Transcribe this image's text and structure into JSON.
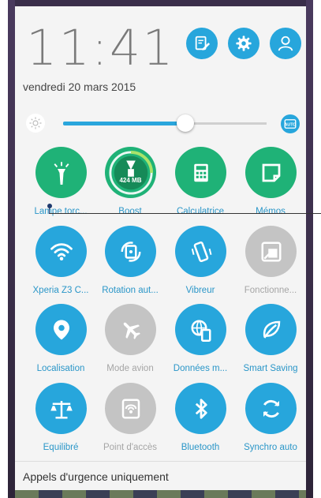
{
  "status": {
    "time": "11:41",
    "date": "vendredi 20 mars 2015"
  },
  "header": {
    "buttons": [
      {
        "icon": "edit-icon"
      },
      {
        "icon": "gear-icon"
      },
      {
        "icon": "user-icon"
      }
    ]
  },
  "brightness": {
    "level": 0.6,
    "auto_label": "AUTO"
  },
  "tiles": [
    {
      "label": "Lampe torc...",
      "icon": "flashlight-icon",
      "state": "on"
    },
    {
      "label": "Boost",
      "icon": "boost-icon",
      "state": "on",
      "badge": "424 MB"
    },
    {
      "label": "Calculatrice",
      "icon": "calculator-icon",
      "state": "on"
    },
    {
      "label": "Mémos",
      "icon": "memo-icon",
      "state": "on"
    },
    {
      "label": "Xperia Z3 C...",
      "icon": "wifi-icon",
      "state": "on"
    },
    {
      "label": "Rotation aut...",
      "icon": "rotation-icon",
      "state": "on"
    },
    {
      "label": "Vibreur",
      "icon": "vibrate-icon",
      "state": "on"
    },
    {
      "label": "Fonctionne...",
      "icon": "screen-mirror-icon",
      "state": "off"
    },
    {
      "label": "Localisation",
      "icon": "location-icon",
      "state": "on"
    },
    {
      "label": "Mode avion",
      "icon": "airplane-icon",
      "state": "off"
    },
    {
      "label": "Données m...",
      "icon": "mobile-data-icon",
      "state": "on"
    },
    {
      "label": "Smart Saving",
      "icon": "leaf-icon",
      "state": "on"
    },
    {
      "label": "Équilibré",
      "icon": "balance-icon",
      "state": "on"
    },
    {
      "label": "Point d'accès",
      "icon": "hotspot-icon",
      "state": "off"
    },
    {
      "label": "Bluetooth",
      "icon": "bluetooth-icon",
      "state": "on"
    },
    {
      "label": "Synchro auto",
      "icon": "sync-icon",
      "state": "on"
    }
  ],
  "colors": {
    "blue": "#27a6dc",
    "green": "#1fb277",
    "off": "#c4c4c4",
    "label_on": "#2a96c8",
    "label_off": "#a5a5a5"
  },
  "footer": {
    "emergency": "Appels d'urgence uniquement"
  }
}
